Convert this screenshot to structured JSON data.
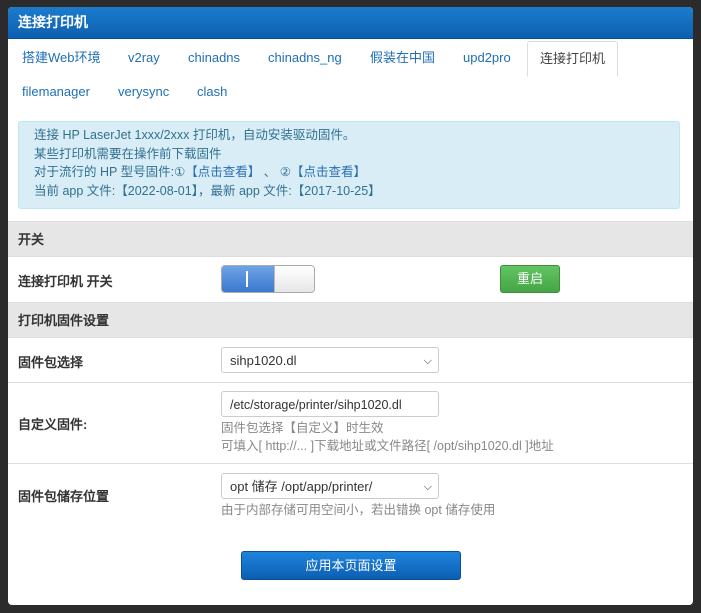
{
  "header": {
    "title": "连接打印机"
  },
  "tabs": [
    {
      "label": "搭建Web环境"
    },
    {
      "label": "v2ray"
    },
    {
      "label": "chinadns"
    },
    {
      "label": "chinadns_ng"
    },
    {
      "label": "假装在中国"
    },
    {
      "label": "upd2pro"
    },
    {
      "label": "连接打印机",
      "active": true
    },
    {
      "label": "filemanager"
    },
    {
      "label": "verysync"
    },
    {
      "label": "clash"
    }
  ],
  "alert": {
    "line1": "连接 HP LaserJet 1xxx/2xxx 打印机，自动安装驱动固件。",
    "line2": "某些打印机需要在操作前下载固件",
    "line3_prefix": "对于流行的 HP 型号固件:①",
    "link1": "【点击查看】",
    "line3_mid": " 、 ②",
    "link2": "【点击查看】",
    "line4": "当前 app 文件:【2022-08-01】，最新 app 文件:【2017-10-25】"
  },
  "sections": {
    "switch_section": "开关",
    "firmware_section": "打印机固件设置"
  },
  "switch_row": {
    "label": "连接打印机 开关",
    "state": "on",
    "restart_label": "重启"
  },
  "firmware_select": {
    "label": "固件包选择",
    "value": "sihp1020.dl"
  },
  "custom_firmware": {
    "label": "自定义固件:",
    "value": "/etc/storage/printer/sihp1020.dl",
    "help1": "固件包选择【自定义】时生效",
    "help2": "可填入[ http://... ]下载地址或文件路径[ /opt/sihp1020.dl ]地址"
  },
  "storage": {
    "label": "固件包储存位置",
    "value": "opt 储存 /opt/app/printer/",
    "help": "由于内部存储可用空间小，若出错换 opt 储存使用"
  },
  "apply_label": "应用本页面设置",
  "colors": {
    "header": "#0d5fb0",
    "tab_link": "#1f6fb5",
    "alert_bg": "#d9edf7",
    "restart_button": "#45a545",
    "apply_button": "#0c5fb3"
  }
}
